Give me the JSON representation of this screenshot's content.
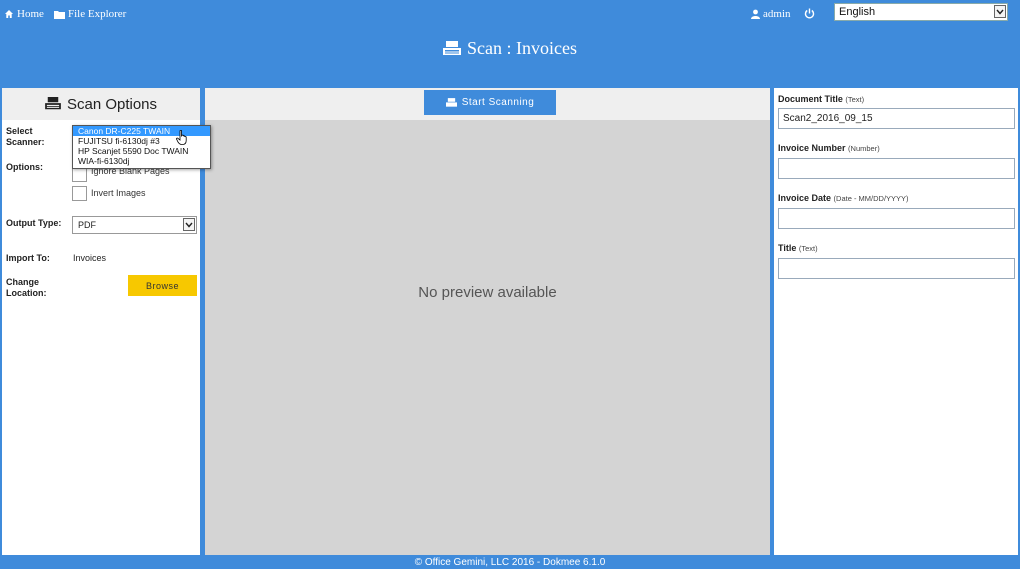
{
  "nav": {
    "home": "Home",
    "file_explorer": "File Explorer"
  },
  "user": {
    "name": "admin"
  },
  "language": {
    "selected": "English"
  },
  "page": {
    "title": "Scan : Invoices"
  },
  "scan_options": {
    "header": "Scan Options",
    "select_scanner_label": "Select Scanner:",
    "scanners": [
      "Canon DR-C225 TWAIN",
      "FUJITSU fi-6130dj #3",
      "HP Scanjet 5590 Doc TWAIN",
      "WIA-fi-6130dj"
    ],
    "options_label": "Options:",
    "opt_ignore_blank": "Ignore Blank Pages",
    "opt_invert": "Invert Images",
    "output_type_label": "Output Type:",
    "output_type_value": "PDF",
    "import_to_label": "Import To:",
    "import_to_value": "Invoices",
    "change_location_label": "Change Location:",
    "browse_label": "Browse"
  },
  "preview": {
    "start_scanning": "Start Scanning",
    "no_preview": "No preview available"
  },
  "fields": {
    "doc_title_label": "Document Title",
    "doc_title_hint": "(Text)",
    "doc_title_value": "Scan2_2016_09_15",
    "invoice_number_label": "Invoice Number",
    "invoice_number_hint": "(Number)",
    "invoice_number_value": "",
    "invoice_date_label": "Invoice Date",
    "invoice_date_hint": "(Date - MM/DD/YYYY)",
    "invoice_date_value": "",
    "title_label": "Title",
    "title_hint": "(Text)",
    "title_value": ""
  },
  "footer": {
    "text": "© Office Gemini, LLC 2016 - Dokmee 6.1.0"
  },
  "colors": {
    "primary": "#3f8bdb",
    "panel_header": "#efefef",
    "preview_bg": "#d4d4d4",
    "browse": "#f7c800",
    "selected_option": "#3399ff"
  }
}
